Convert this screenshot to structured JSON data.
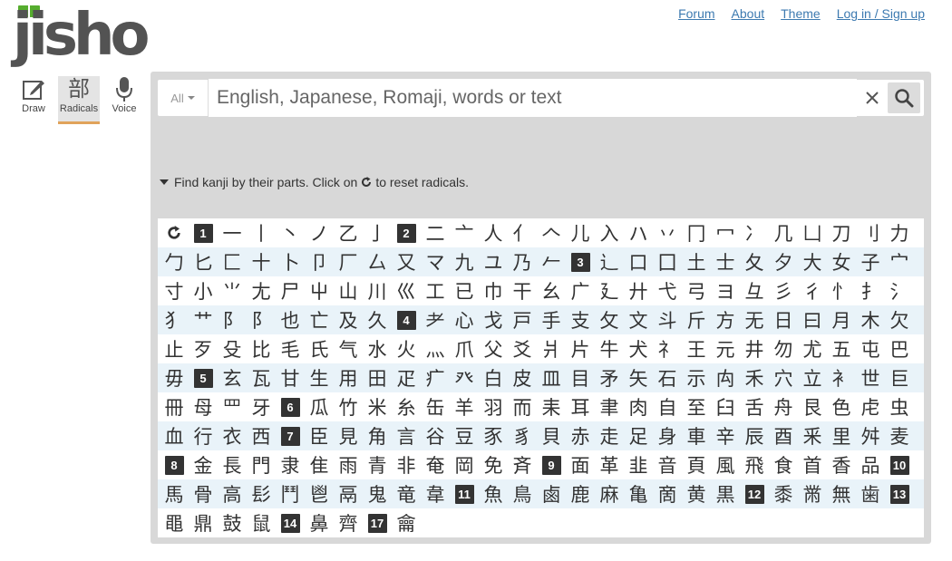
{
  "logo": {
    "text": "jisho"
  },
  "nav": [
    {
      "label": "Forum"
    },
    {
      "label": "About"
    },
    {
      "label": "Theme"
    },
    {
      "label": "Log in / Sign up"
    }
  ],
  "tools": [
    {
      "label": "Draw",
      "icon": "pencil-icon"
    },
    {
      "label": "Radicals",
      "icon": "部",
      "active": true
    },
    {
      "label": "Voice",
      "icon": "microphone-icon"
    }
  ],
  "search": {
    "scope": "All",
    "placeholder": "English, Japanese, Romaji, words or text"
  },
  "radical_hint": {
    "before": "Find kanji by their parts. Click on",
    "after": "to reset radicals."
  },
  "radical_rows": [
    [
      "↻",
      "#1",
      "一",
      "丨",
      "丶",
      "ノ",
      "乙",
      "亅",
      "#2",
      "二",
      "亠",
      "人",
      "亻",
      "𠆢",
      "儿",
      "入",
      "ハ",
      "丷",
      "冂",
      "冖",
      "冫",
      "几",
      "凵",
      "刀",
      "刂",
      "力"
    ],
    [
      "勹",
      "匕",
      "匚",
      "十",
      "卜",
      "卩",
      "厂",
      "厶",
      "又",
      "マ",
      "九",
      "ユ",
      "乃",
      "𠂉",
      "#3",
      "⻌",
      "口",
      "囗",
      "土",
      "士",
      "夂",
      "夕",
      "大",
      "女",
      "子",
      "宀"
    ],
    [
      "寸",
      "小",
      "⺌",
      "尢",
      "尸",
      "屮",
      "山",
      "川",
      "巛",
      "工",
      "已",
      "巾",
      "干",
      "幺",
      "广",
      "廴",
      "廾",
      "弋",
      "弓",
      "ヨ",
      "彑",
      "彡",
      "彳",
      "忄",
      "扌",
      "氵"
    ],
    [
      "犭",
      "艹",
      "⻖",
      "阝",
      "也",
      "亡",
      "及",
      "久",
      "#4",
      "耂",
      "心",
      "戈",
      "戸",
      "手",
      "支",
      "攵",
      "文",
      "斗",
      "斤",
      "方",
      "无",
      "日",
      "曰",
      "月",
      "木",
      "欠"
    ],
    [
      "止",
      "歹",
      "殳",
      "比",
      "毛",
      "氏",
      "气",
      "水",
      "火",
      "灬",
      "爪",
      "父",
      "爻",
      "爿",
      "片",
      "牛",
      "犬",
      "礻",
      "王",
      "元",
      "井",
      "勿",
      "尤",
      "五",
      "屯",
      "巴"
    ],
    [
      "毋",
      "#5",
      "玄",
      "瓦",
      "甘",
      "生",
      "用",
      "田",
      "疋",
      "疒",
      "癶",
      "白",
      "皮",
      "皿",
      "目",
      "矛",
      "矢",
      "石",
      "示",
      "禸",
      "禾",
      "穴",
      "立",
      "衤",
      "世",
      "巨"
    ],
    [
      "冊",
      "母",
      "罒",
      "牙",
      "#6",
      "瓜",
      "竹",
      "米",
      "糸",
      "缶",
      "羊",
      "羽",
      "而",
      "耒",
      "耳",
      "聿",
      "肉",
      "自",
      "至",
      "臼",
      "舌",
      "舟",
      "艮",
      "色",
      "虍",
      "虫"
    ],
    [
      "血",
      "行",
      "衣",
      "西",
      "#7",
      "臣",
      "見",
      "角",
      "言",
      "谷",
      "豆",
      "豕",
      "豸",
      "貝",
      "赤",
      "走",
      "足",
      "身",
      "車",
      "辛",
      "辰",
      "酉",
      "釆",
      "里",
      "舛",
      "麦"
    ],
    [
      "#8",
      "金",
      "長",
      "門",
      "隶",
      "隹",
      "雨",
      "青",
      "非",
      "奄",
      "岡",
      "免",
      "斉",
      "#9",
      "面",
      "革",
      "韭",
      "音",
      "頁",
      "風",
      "飛",
      "食",
      "首",
      "香",
      "品",
      "#10"
    ],
    [
      "馬",
      "骨",
      "高",
      "髟",
      "鬥",
      "鬯",
      "鬲",
      "鬼",
      "竜",
      "韋",
      "#11",
      "魚",
      "鳥",
      "鹵",
      "鹿",
      "麻",
      "亀",
      "啇",
      "黄",
      "黒",
      "#12",
      "黍",
      "黹",
      "無",
      "歯",
      "#13"
    ],
    [
      "黽",
      "鼎",
      "鼓",
      "鼠",
      "#14",
      "鼻",
      "齊",
      "#17",
      "龠"
    ]
  ]
}
